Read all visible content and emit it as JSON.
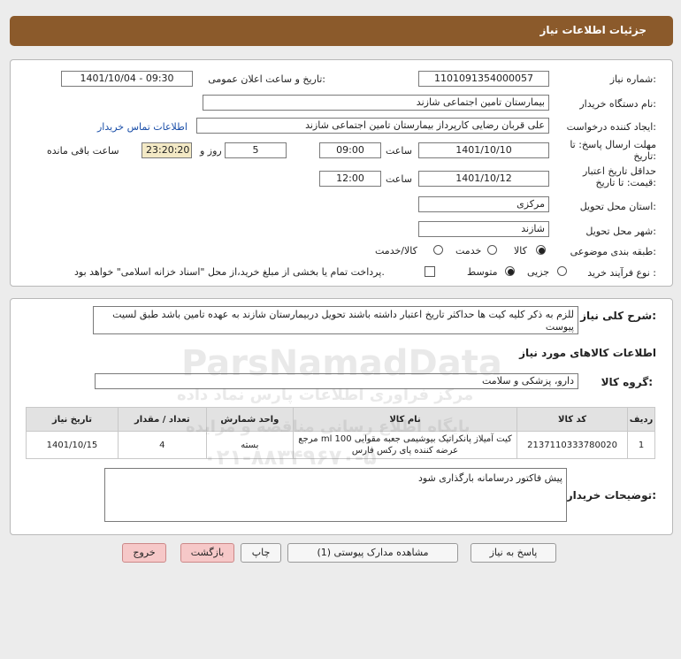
{
  "header": {
    "title": "جزئیات اطلاعات نیاز"
  },
  "form": {
    "need_number_label": "شماره نیاز:",
    "need_number": "1101091354000057",
    "announce_label": "تاریخ و ساعت اعلان عمومی:",
    "announce_value": "1401/10/04 - 09:30",
    "buyer_org_label": "نام دستگاه خریدار:",
    "buyer_org": "بیمارستان تامین اجتماعی شازند",
    "creator_label": "ایجاد کننده درخواست:",
    "creator": "علی قربان  رضایی کارپرداز بیمارستان تامین اجتماعی شازند",
    "contact_link": "اطلاعات تماس خریدار",
    "deadline_label": "مهلت ارسال پاسخ: تا تاریخ:",
    "deadline_date": "1401/10/10",
    "time_label": "ساعت",
    "deadline_time": "09:00",
    "days_value": "5",
    "days_label": "روز و",
    "remaining_time": "23:20:20",
    "remaining_label": "ساعت باقی مانده",
    "validity_label": "حداقل تاریخ اعتبار قیمت: تا تاریخ:",
    "validity_date": "1401/10/12",
    "validity_time": "12:00",
    "province_label": "استان محل تحویل:",
    "province": "مرکزی",
    "city_label": "شهر محل تحویل:",
    "city": "شازند",
    "category_label": "طبقه بندی موضوعی:",
    "category_options": [
      "کالا",
      "خدمت",
      "کالا/خدمت"
    ],
    "category_selected": "کالا",
    "process_label": "نوع فرآیند خرید :",
    "process_options": [
      "جزیی",
      "متوسط"
    ],
    "process_selected": "متوسط",
    "payment_note": "پرداخت تمام یا بخشی از مبلغ خرید،از محل \"اسناد خزانه اسلامی\" خواهد بود."
  },
  "description": {
    "label": "شرح کلی نیاز:",
    "text": "للزم به ذکر کلیه کیت ها حداکثر تاریخ اعتبار داشته باشند تحویل دربیمارستان شازند به عهده تامین باشد طبق لسیت پیوست"
  },
  "goods": {
    "section_title": "اطلاعات کالاهای مورد نیاز",
    "group_label": "گروه کالا:",
    "group_value": "دارو، پزشکی و سلامت",
    "columns": [
      "ردیف",
      "کد کالا",
      "نام کالا",
      "واحد شمارش",
      "تعداد / مقدار",
      "تاریخ نیاز"
    ],
    "rows": [
      {
        "row": "1",
        "code": "2137110333780020",
        "name_line1": "کیت آمیلاز پانکراتیک بیوشیمی جعبه مقوایی 100 ml مرجع",
        "name_line2": "عرضه کننده پای رکس فارس",
        "unit": "بسته",
        "qty": "4",
        "date": "1401/10/15"
      }
    ]
  },
  "buyer_notes": {
    "label": "توضیحات خریدار:",
    "text": "پیش فاکتور درسامانه بارگذاری شود"
  },
  "buttons": {
    "reply": "پاسخ به نیاز",
    "attachments": "مشاهده مدارک پیوستی (1)",
    "print": "چاپ",
    "back": "بازگشت",
    "exit": "خروج"
  },
  "watermark": {
    "brand": "ParsNamadData",
    "line1": "مرکز فراوری اطلاعات پارس نماد داده",
    "line2": "پایگاه اطلاع رسانی مناقصه و مزایده",
    "phone": "۰۲۱-۸۸۳۴۹۶۷۰-۵"
  }
}
